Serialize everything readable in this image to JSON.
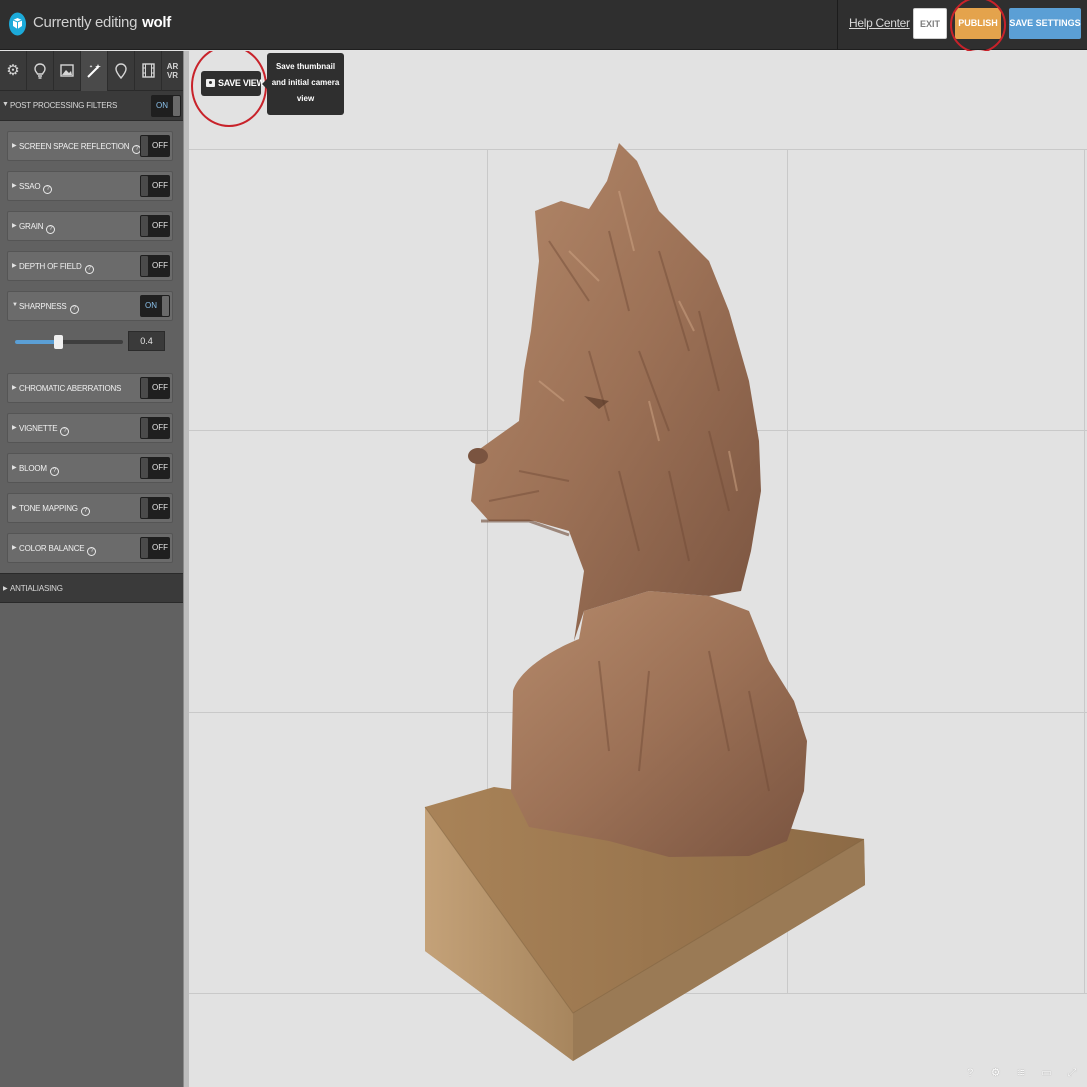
{
  "header": {
    "editing_label": "Currently editing",
    "model_name": "wolf",
    "help_label": "Help Center",
    "exit_label": "EXIT",
    "publish_label": "PUBLISH",
    "save_settings_label": "SAVE SETTINGS"
  },
  "sidebar": {
    "tabs": [
      {
        "icon": "gear-icon",
        "glyph": "⚙"
      },
      {
        "icon": "lightbulb-icon",
        "glyph": "♀"
      },
      {
        "icon": "image-icon",
        "glyph": "▣"
      },
      {
        "icon": "magic-wand-icon",
        "glyph": "✨"
      },
      {
        "icon": "pin-icon",
        "glyph": "◊"
      },
      {
        "icon": "film-icon",
        "glyph": "▦"
      },
      {
        "icon": "ar-vr-icon",
        "glyph": "AR VR"
      }
    ],
    "post_processing": {
      "label": "POST PROCESSING FILTERS",
      "state": "ON"
    },
    "filters": [
      {
        "name": "SCREEN SPACE REFLECTION",
        "state": "OFF"
      },
      {
        "name": "SSAO",
        "state": "OFF"
      },
      {
        "name": "GRAIN",
        "state": "OFF"
      },
      {
        "name": "DEPTH OF FIELD",
        "state": "OFF"
      },
      {
        "name": "SHARPNESS",
        "state": "ON"
      },
      {
        "name": "CHROMATIC ABERRATIONS",
        "state": "OFF"
      },
      {
        "name": "VIGNETTE",
        "state": "OFF"
      },
      {
        "name": "BLOOM",
        "state": "OFF"
      },
      {
        "name": "TONE MAPPING",
        "state": "OFF"
      },
      {
        "name": "COLOR BALANCE",
        "state": "OFF"
      }
    ],
    "sharpness_value": "0.4",
    "sharpness_level": 0.4,
    "antialiasing_label": "ANTIALIASING"
  },
  "viewport": {
    "save_view_label": "SAVE VIEW",
    "tooltip_line1": "Save thumbnail",
    "tooltip_line2": "and initial camera",
    "tooltip_line3": "view",
    "bottom_icons": [
      "help-icon",
      "settings-icon",
      "layers-icon",
      "vr-headset-icon",
      "fullscreen-icon"
    ]
  },
  "colors": {
    "publish": "#e4a34c",
    "save_settings": "#5b9fd5",
    "annotation_circle": "#c8222a",
    "toggle_on_text": "#8ac0ea"
  }
}
